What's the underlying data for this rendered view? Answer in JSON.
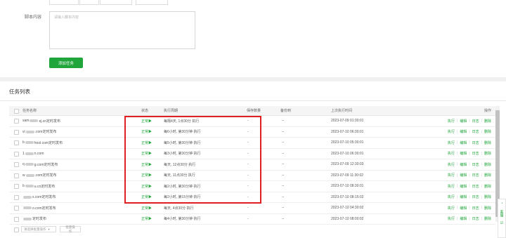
{
  "form": {
    "script_label": "脚本内容",
    "script_placeholder": "请输入脚本内容",
    "add_button": "添加任务"
  },
  "list": {
    "title": "任务列表",
    "columns": [
      "任务名称",
      "状态",
      "执行周期",
      "保存数量",
      "备份到",
      "上次执行时间",
      "操作"
    ],
    "rows": [
      {
        "name_pre": "sam",
        "name_post": "ej.cn定时发布",
        "status": "正常▶",
        "cycle": "每隔4天, 1点30分 执行",
        "count": "-",
        "backup": "--",
        "last": "2023-07-09 01:30:01"
      },
      {
        "name_pre": "vi",
        "name_post": ".com定时发布",
        "status": "正常▶",
        "cycle": "每6小时, 第30分钟 执行",
        "count": "-",
        "backup": "--",
        "last": "2023-07-10 06:30:01"
      },
      {
        "name_pre": "b",
        "name_post": "hool.com定时发布",
        "status": "正常▶",
        "cycle": "每5小时, 第30分钟 执行",
        "count": "-",
        "backup": "--",
        "last": "2023-07-10 05:30:01"
      },
      {
        "name_pre": "1",
        "name_post": "n.com",
        "status": "正常▶",
        "cycle": "每3小时, 第30分钟 执行",
        "count": "-",
        "backup": "--",
        "last": "2023-07-10 06:30:01"
      },
      {
        "name_pre": "q",
        "name_post": "g.com定时发布",
        "status": "正常▶",
        "cycle": "每天, 12点30分 执行",
        "count": "-",
        "backup": "--",
        "last": "2023-07-09 12:30:03"
      },
      {
        "name_pre": "w",
        "name_post": ".com定时发布",
        "status": "正常▶",
        "cycle": "每天, 11点30分 执行",
        "count": "-",
        "backup": "--",
        "last": "2023-07-09 11:30:02"
      },
      {
        "name_pre": "b",
        "name_post": "u.cn定时发布",
        "status": "正常▶",
        "cycle": "每2小时, 第30分钟 执行",
        "count": "-",
        "backup": "--",
        "last": "2023-07-10 08:30:01"
      },
      {
        "name_pre": "",
        "name_post": "x.com定时发布",
        "status": "正常▶",
        "cycle": "每2小时, 第15分钟 执行",
        "count": "-",
        "backup": "--",
        "last": "2023-07-10 08:15:02"
      },
      {
        "name_pre": "",
        "name_post": "o.com定时发布",
        "status": "正常▶",
        "cycle": "每天, 4点30分 执行",
        "count": "-",
        "backup": "--",
        "last": "2023-07-10 04:30:02"
      },
      {
        "name_pre": "",
        "name_post": "定时发布",
        "status": "正常▶",
        "cycle": "每4小时, 第30分钟 执行",
        "count": "-",
        "backup": "--",
        "last": "2023-07-10 08:00:02"
      }
    ],
    "ops": {
      "run": "执行",
      "edit": "编辑",
      "log": "日志",
      "del": "删除"
    },
    "bulk_select_placeholder": "请选择批量操作",
    "bulk_button": "批量操作"
  },
  "side": {
    "chat": "客服",
    "review": "评价"
  }
}
